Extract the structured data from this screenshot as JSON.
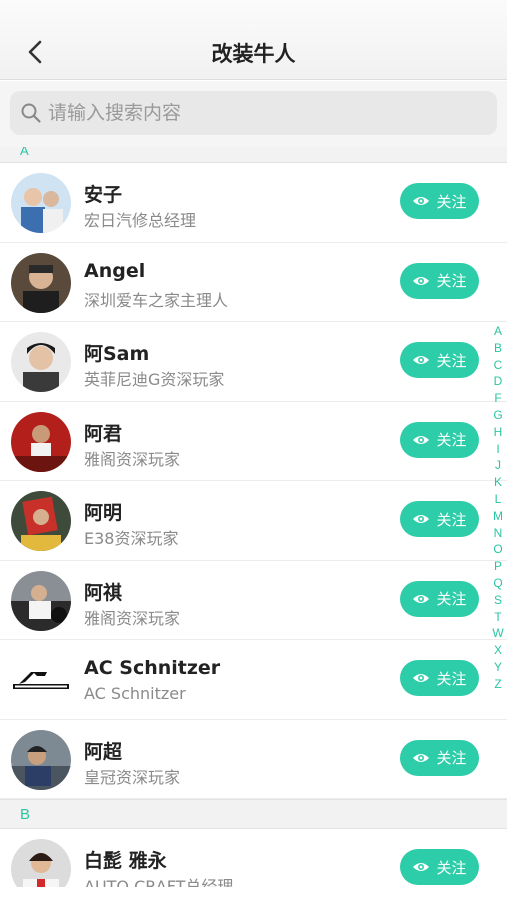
{
  "header": {
    "title": "改装牛人"
  },
  "search": {
    "placeholder": "请输入搜索内容"
  },
  "sections": [
    {
      "letter": "A",
      "people": [
        {
          "name": "安子",
          "desc": "宏日汽修总经理"
        },
        {
          "name": "Angel",
          "desc": "深圳爱车之家主理人"
        },
        {
          "name": "阿Sam",
          "desc": "英菲尼迪G资深玩家"
        },
        {
          "name": "阿君",
          "desc": "雅阁资深玩家"
        },
        {
          "name": "阿明",
          "desc": "E38资深玩家"
        },
        {
          "name": "阿祺",
          "desc": "雅阁资深玩家"
        },
        {
          "name": "AC Schnitzer",
          "desc": "AC Schnitzer"
        },
        {
          "name": "阿超",
          "desc": "皇冠资深玩家"
        }
      ]
    },
    {
      "letter": "B",
      "people": [
        {
          "name": "白髭 雅永",
          "desc": "AUTO CRAFT总经理"
        }
      ]
    }
  ],
  "follow_label": "关注",
  "index_letters": [
    "A",
    "B",
    "C",
    "D",
    "F",
    "G",
    "H",
    "I",
    "J",
    "K",
    "L",
    "M",
    "N",
    "O",
    "P",
    "Q",
    "S",
    "T",
    "W",
    "X",
    "Y",
    "Z"
  ],
  "colors": {
    "accent": "#2ccda8",
    "index": "#2bc5a3"
  },
  "icons": {
    "back": "chevron-left-icon",
    "search": "search-icon",
    "follow": "eye-icon"
  }
}
